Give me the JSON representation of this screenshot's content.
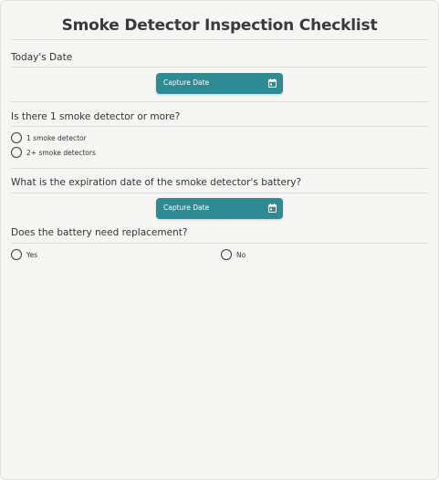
{
  "title": "Smoke Detector Inspection Checklist",
  "questions": {
    "todays_date": {
      "label": "Today's Date",
      "button_label": "Capture Date",
      "button_icon": "calendar-icon"
    },
    "detector_count": {
      "label": "Is there 1 smoke detector or more?",
      "options": [
        "1 smoke detector",
        "2+ smoke detectors"
      ]
    },
    "battery_expiration": {
      "label": "What is the expiration date of the smoke detector's battery?",
      "button_label": "Capture Date",
      "button_icon": "calendar-icon"
    },
    "battery_replacement": {
      "label": "Does the battery need replacement?",
      "options": [
        "Yes",
        "No"
      ]
    }
  },
  "colors": {
    "accent": "#2e8a93",
    "background": "#f5f5f3",
    "text": "#333333"
  }
}
